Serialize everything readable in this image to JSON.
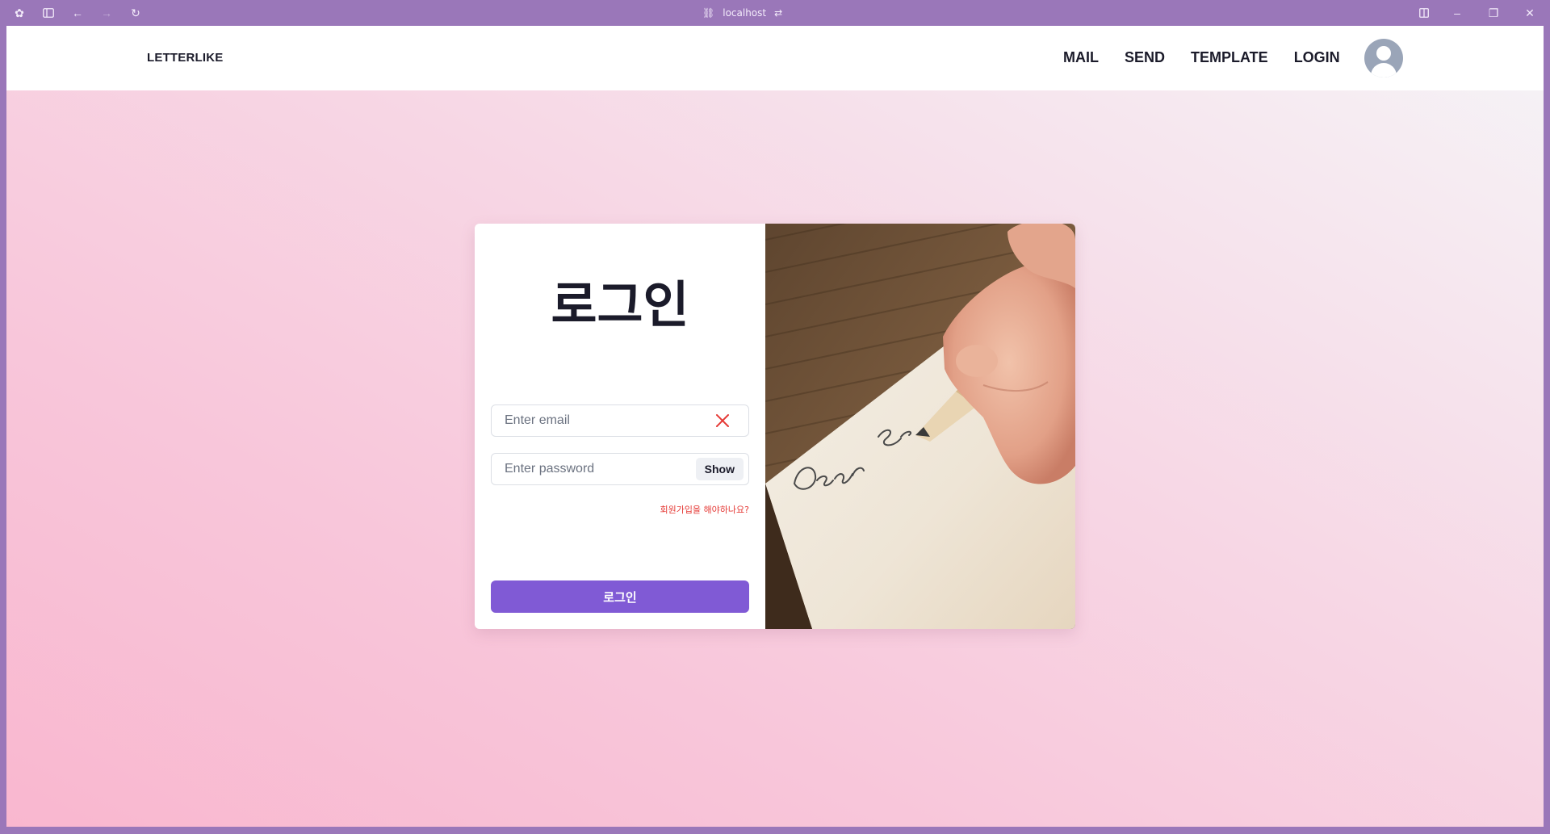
{
  "browser": {
    "url": "localhost",
    "icons": [
      "extensions-icon",
      "sidebar-toggle-icon",
      "back-arrow-icon",
      "forward-arrow-icon",
      "reload-icon",
      "link-icon",
      "site-settings-icon",
      "split-view-icon",
      "minimize-icon",
      "restore-icon",
      "close-icon"
    ]
  },
  "nav": {
    "brand": "LETTERLIKE",
    "links": [
      "MAIL",
      "SEND",
      "TEMPLATE",
      "LOGIN"
    ],
    "avatar_icon": "user-avatar-icon"
  },
  "login": {
    "title": "로그인",
    "email_placeholder": "Enter email",
    "password_placeholder": "Enter password",
    "show_label": "Show",
    "signup_prompt": "회원가입을 해야하나요?",
    "submit_label": "로그인",
    "photo_text": "Dear S"
  },
  "colors": {
    "primary": "#805ad5",
    "error": "#e53935",
    "chrome": "#9a77b9"
  }
}
